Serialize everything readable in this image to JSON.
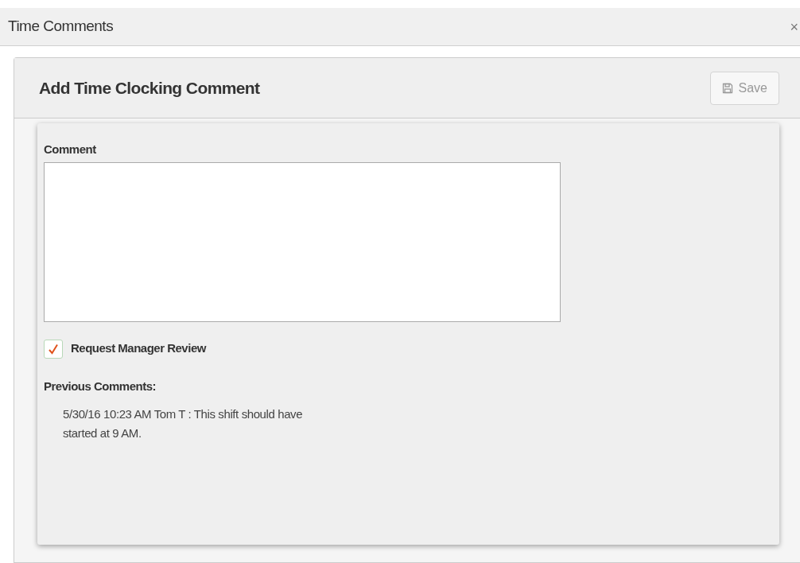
{
  "window": {
    "title": "Time Comments",
    "close": "×"
  },
  "panel": {
    "title": "Add Time Clocking Comment",
    "save_button": {
      "label": "Save",
      "disabled": true
    }
  },
  "form": {
    "comment_label": "Comment",
    "review": {
      "label": "Request Manager Review",
      "checked": true
    },
    "previous_label": "Previous Comments:",
    "previous_comments": [
      "5/30/16 10:23 AM Tom T : This shift should have started at 9 AM."
    ]
  }
}
